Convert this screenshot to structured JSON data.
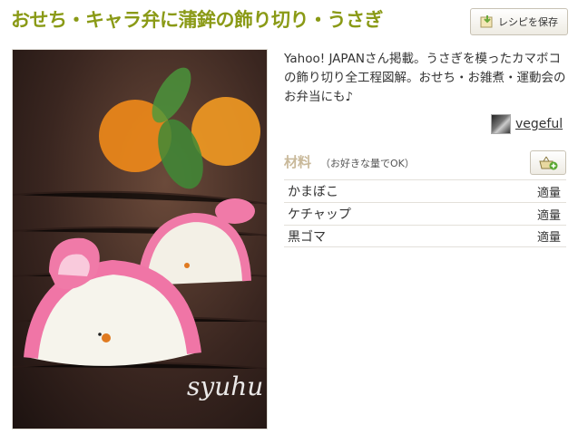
{
  "recipe": {
    "title": "おせち・キャラ弁に蒲鉾の飾り切り・うさぎ",
    "save_label": "レシピを保存",
    "photo_watermark": "syuhu",
    "description": "Yahoo! JAPANさん掲載。うさぎを模ったカマボコの飾り切り全工程図解。おせち・お雑煮・運動会のお弁当にも♪",
    "author": "vegeful"
  },
  "ingredients": {
    "heading": "材料",
    "note": "（お好きな量でOK）",
    "items": [
      {
        "name": "かまぼこ",
        "qty": "適量"
      },
      {
        "name": "ケチャップ",
        "qty": "適量"
      },
      {
        "name": "黒ゴマ",
        "qty": "適量"
      }
    ]
  },
  "colors": {
    "title": "#8a9a16",
    "ingredients_heading": "#c9b99a"
  },
  "icons": {
    "save": "save-to-folder-icon",
    "cart": "shopping-basket-add-icon"
  }
}
